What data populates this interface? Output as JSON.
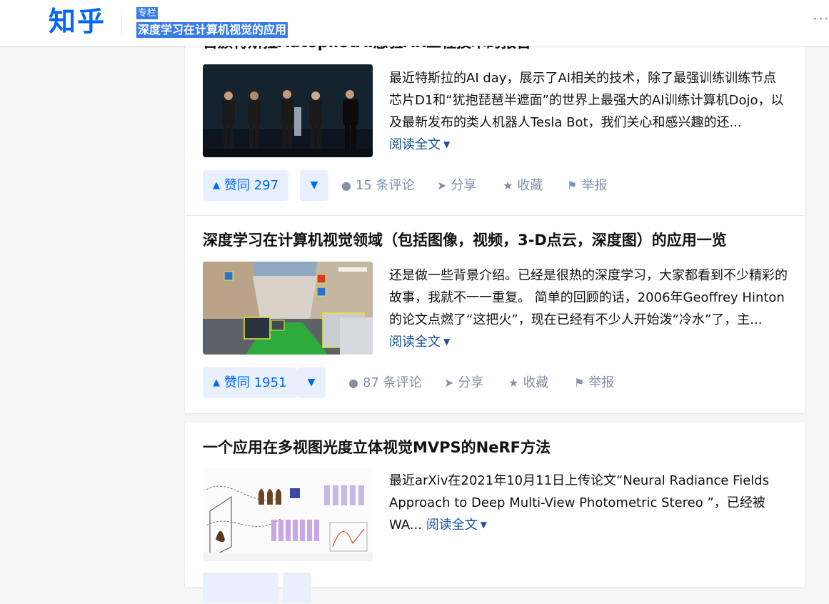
{
  "header": {
    "logo": "知乎",
    "column_tag": "专栏",
    "column_title": "深度学习在计算机视觉的应用",
    "more_label": "···"
  },
  "articles": [
    {
      "title": "首颁特斯拉AutopilotAI感验AR工程技术的报告",
      "excerpt": "最近特斯拉的AI day，展示了AI相关的技术，除了最强训练训练节点芯片D1和“犹抱琵琶半遮面”的世界上最强大的AI训练计算机Dojo，以及最新发布的类人机器人Tesla Bot，我们关心和感兴趣的还...",
      "read_more": "阅读全文",
      "upvote_label": "赞同 297",
      "comments_label": "15 条评论",
      "share_label": "分享",
      "favorite_label": "收藏",
      "report_label": "举报"
    },
    {
      "title": "深度学习在计算机视觉领域（包括图像，视频，3-D点云，深度图）的应用一览",
      "excerpt": "还是做一些背景介绍。已经是很热的深度学习，大家都看到不少精彩的故事，我就不一一重复。 简单的回顾的话，2006年Geoffrey Hinton的论文点燃了“这把火”，现在已经有不少人开始泼“冷水”了，主...",
      "read_more": "阅读全文",
      "upvote_label": "赞同 1951",
      "comments_label": "87 条评论",
      "share_label": "分享",
      "favorite_label": "收藏",
      "report_label": "举报"
    },
    {
      "title": "一个应用在多视图光度立体视觉MVPS的NeRF方法",
      "excerpt": "最近arXiv在2021年10月11日上传论文“Neural Radiance Fields Approach to Deep Multi-View Photometric Stereo ”，已经被WA...",
      "read_more": "阅读全文"
    }
  ],
  "icons": {
    "upvote": "triangle-up-icon",
    "downvote": "triangle-down-icon",
    "comment": "comment-bubble-icon",
    "share": "paper-plane-icon",
    "favorite": "star-icon",
    "report": "flag-icon",
    "read_more": "chevron-down-icon",
    "more": "ellipsis-icon"
  },
  "colors": {
    "brand": "#0066ff",
    "link": "#175199",
    "muted": "#8590a6",
    "vote_bg": "#e8f0fd",
    "selection": "#3a7ce6"
  }
}
